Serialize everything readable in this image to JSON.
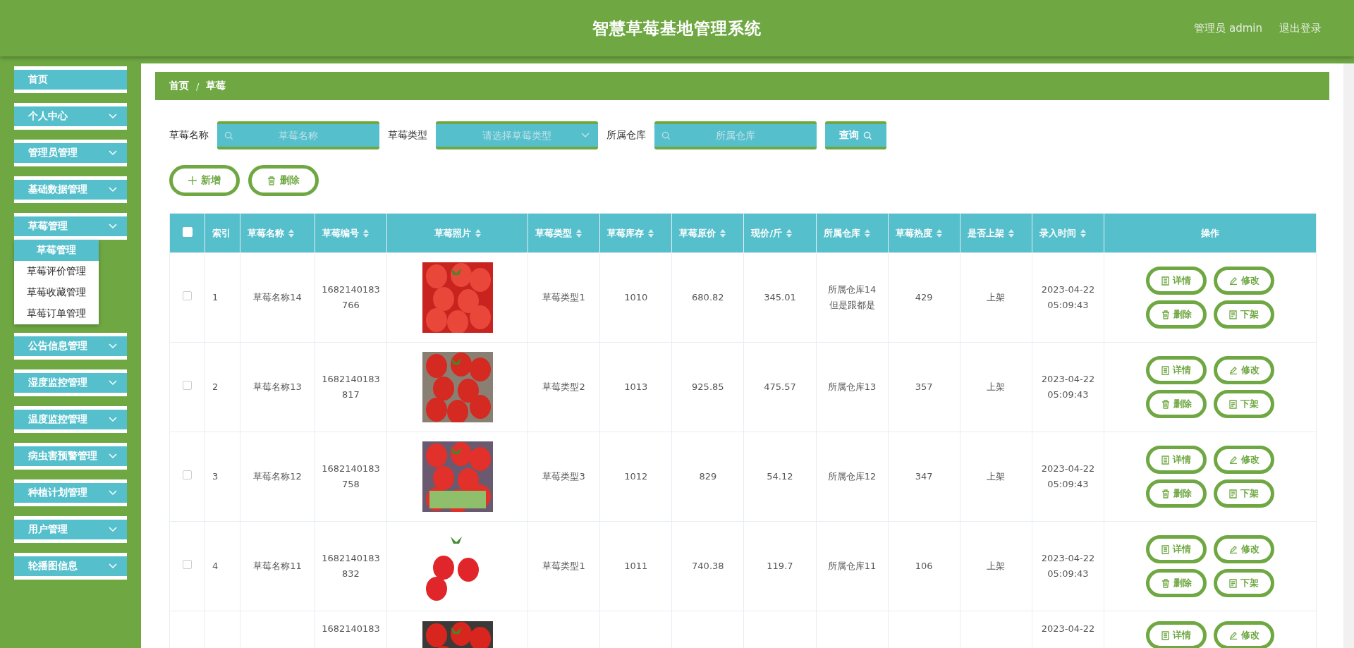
{
  "header": {
    "title": "智慧草莓基地管理系统",
    "user": "管理员 admin",
    "logout": "退出登录"
  },
  "sidebar": {
    "items": [
      {
        "label": "首页",
        "kind": "link"
      },
      {
        "label": "个人中心",
        "kind": "menu"
      },
      {
        "label": "管理员管理",
        "kind": "menu"
      },
      {
        "label": "基础数据管理",
        "kind": "menu"
      },
      {
        "label": "草莓管理",
        "kind": "menu",
        "children": [
          {
            "label": "草莓管理",
            "selected": true
          },
          {
            "label": "草莓评价管理",
            "selected": false
          },
          {
            "label": "草莓收藏管理",
            "selected": false
          },
          {
            "label": "草莓订单管理",
            "selected": false
          }
        ]
      },
      {
        "label": "公告信息管理",
        "kind": "menu"
      },
      {
        "label": "湿度监控管理",
        "kind": "menu"
      },
      {
        "label": "温度监控管理",
        "kind": "menu"
      },
      {
        "label": "病虫害预警管理",
        "kind": "menu"
      },
      {
        "label": "种植计划管理",
        "kind": "menu"
      },
      {
        "label": "用户管理",
        "kind": "menu"
      },
      {
        "label": "轮播图信息",
        "kind": "menu"
      }
    ]
  },
  "breadcrumb": [
    "首页",
    "草莓"
  ],
  "breadcrumb_separator": "/",
  "filters": [
    {
      "label": "草莓名称",
      "kind": "input",
      "placeholder": "草莓名称"
    },
    {
      "label": "草莓类型",
      "kind": "select",
      "placeholder": "请选择草莓类型"
    },
    {
      "label": "所属仓库",
      "kind": "input",
      "placeholder": "所属仓库"
    }
  ],
  "search_button": "查询",
  "actions": [
    {
      "label": "新增",
      "kind": "add"
    },
    {
      "label": "删除",
      "kind": "delete"
    }
  ],
  "table": {
    "all_checked": false,
    "columns": [
      {
        "label": "索引",
        "sortable": false
      },
      {
        "label": "草莓名称",
        "sortable": true
      },
      {
        "label": "草莓编号",
        "sortable": true
      },
      {
        "label": "草莓照片",
        "sortable": true
      },
      {
        "label": "草莓类型",
        "sortable": true
      },
      {
        "label": "草莓库存",
        "sortable": true
      },
      {
        "label": "草莓原价",
        "sortable": true
      },
      {
        "label": "现价/斤",
        "sortable": true
      },
      {
        "label": "所属仓库",
        "sortable": true
      },
      {
        "label": "草莓热度",
        "sortable": true
      },
      {
        "label": "是否上架",
        "sortable": true
      },
      {
        "label": "录入时间",
        "sortable": true
      },
      {
        "label": "操作",
        "sortable": false
      }
    ],
    "rows": [
      {
        "checked": false,
        "cells": [
          "1",
          "草莓名称14",
          [
            "1682140183",
            "766"
          ],
          {
            "kind": "picture"
          },
          "草莓类型1",
          "1010",
          "680.82",
          "345.01",
          [
            "所属仓库14",
            "但是跟都是"
          ],
          "429",
          "上架",
          [
            "2023-04-22",
            "05:09:43"
          ]
        ],
        "actions": [
          {
            "label": "详情",
            "kind": "detail"
          },
          {
            "label": "修改",
            "kind": "edit"
          },
          {
            "label": "删除",
            "kind": "delete"
          },
          {
            "label": "下架",
            "kind": "offline"
          }
        ]
      },
      {
        "checked": false,
        "cells": [
          "2",
          "草莓名称13",
          [
            "1682140183",
            "817"
          ],
          {
            "kind": "picture"
          },
          "草莓类型2",
          "1013",
          "925.85",
          "475.57",
          "所属仓库13",
          "357",
          "上架",
          [
            "2023-04-22",
            "05:09:43"
          ]
        ],
        "actions": [
          {
            "label": "详情",
            "kind": "detail"
          },
          {
            "label": "修改",
            "kind": "edit"
          },
          {
            "label": "删除",
            "kind": "delete"
          },
          {
            "label": "下架",
            "kind": "offline"
          }
        ]
      },
      {
        "checked": false,
        "cells": [
          "3",
          "草莓名称12",
          [
            "1682140183",
            "758"
          ],
          {
            "kind": "picture"
          },
          "草莓类型3",
          "1012",
          "829",
          "54.12",
          "所属仓库12",
          "347",
          "上架",
          [
            "2023-04-22",
            "05:09:43"
          ]
        ],
        "actions": [
          {
            "label": "详情",
            "kind": "detail"
          },
          {
            "label": "修改",
            "kind": "edit"
          },
          {
            "label": "删除",
            "kind": "delete"
          },
          {
            "label": "下架",
            "kind": "offline"
          }
        ]
      },
      {
        "checked": false,
        "cells": [
          "4",
          "草莓名称11",
          [
            "1682140183",
            "832"
          ],
          {
            "kind": "picture"
          },
          "草莓类型1",
          "1011",
          "740.38",
          "119.7",
          "所属仓库11",
          "106",
          "上架",
          [
            "2023-04-22",
            "05:09:43"
          ]
        ],
        "actions": [
          {
            "label": "详情",
            "kind": "detail"
          },
          {
            "label": "修改",
            "kind": "edit"
          },
          {
            "label": "删除",
            "kind": "delete"
          },
          {
            "label": "下架",
            "kind": "offline"
          }
        ]
      },
      {
        "partial": true,
        "cells": [
          "",
          "",
          [
            "1682140183"
          ],
          {
            "kind": "picture"
          },
          "",
          "",
          "",
          "",
          "",
          "",
          "",
          [
            "2023-04-22"
          ]
        ],
        "actions": [
          {
            "label": "详情",
            "kind": "detail"
          },
          {
            "label": "修改",
            "kind": "edit"
          }
        ]
      }
    ]
  }
}
